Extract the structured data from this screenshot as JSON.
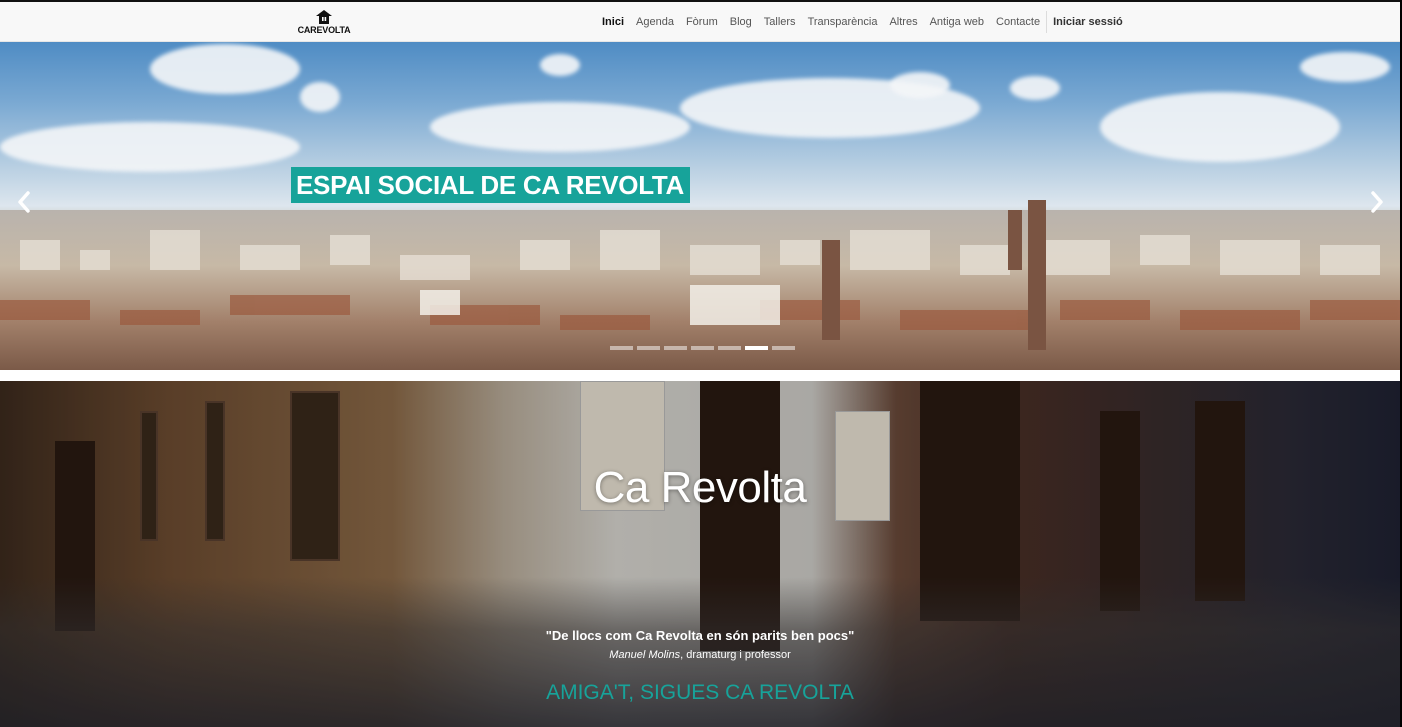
{
  "navbar": {
    "logo_text": "CAREVOLTA",
    "items": [
      {
        "label": "Inici",
        "active": true
      },
      {
        "label": "Agenda"
      },
      {
        "label": "Fòrum"
      },
      {
        "label": "Blog"
      },
      {
        "label": "Tallers"
      },
      {
        "label": "Transparència"
      },
      {
        "label": "Altres"
      },
      {
        "label": "Antiga web"
      },
      {
        "label": "Contacte"
      }
    ],
    "login_label": "Iniciar sessió"
  },
  "carousel": {
    "slide_title": "ESPAI SOCIAL DE CA REVOLTA",
    "prev_glyph": "‹",
    "next_glyph": "›",
    "indicator_count": 7,
    "active_indicator": 6
  },
  "banner": {
    "title": "Ca Revolta",
    "quote": "\"De llocs com Ca Revolta en són parits ben pocs\"",
    "quote_author_name": "Manuel Molins",
    "quote_author_role": ", dramaturg i professor",
    "cta": "AMIGA'T, SIGUES CA REVOLTA"
  },
  "colors": {
    "accent": "#17a39a",
    "navbar_bg": "#f8f8f8"
  }
}
